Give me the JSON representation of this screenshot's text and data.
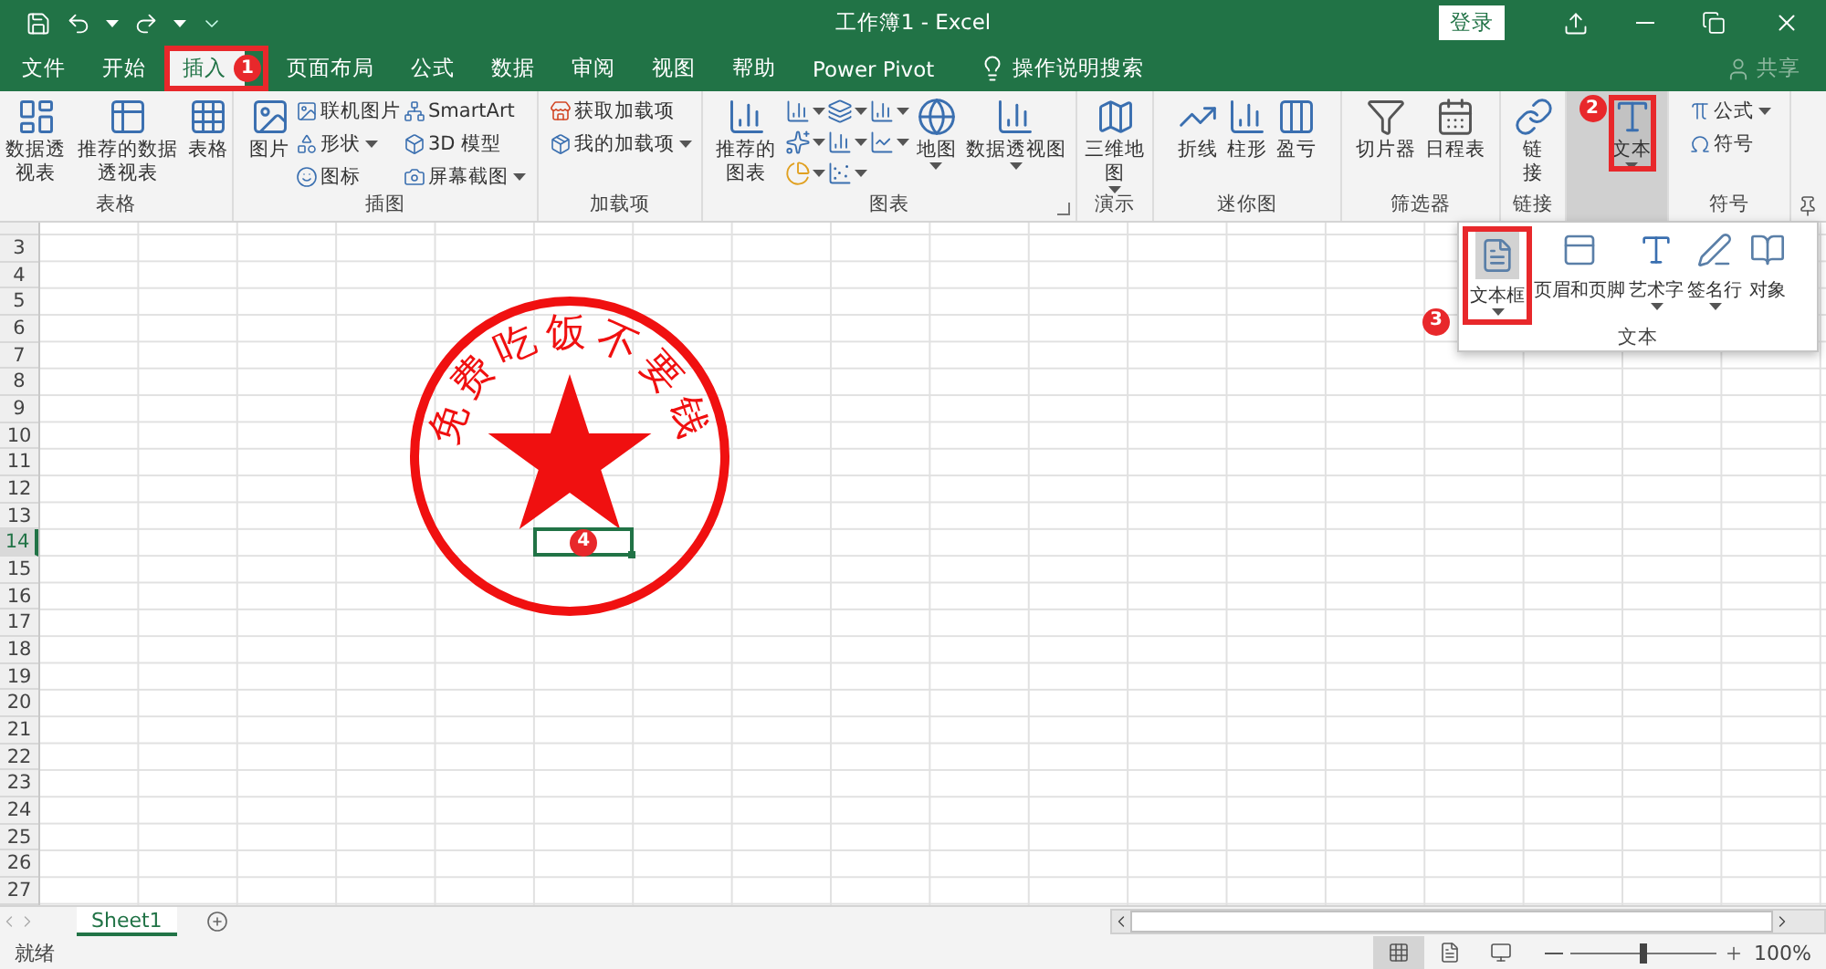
{
  "title_bar": {
    "title": "工作簿1 - Excel",
    "sign_in": "登录"
  },
  "tabs": [
    {
      "label": "文件",
      "selected": false
    },
    {
      "label": "开始",
      "selected": false
    },
    {
      "label": "插入",
      "selected": true,
      "annotation": "1"
    },
    {
      "label": "页面布局",
      "selected": false
    },
    {
      "label": "公式",
      "selected": false
    },
    {
      "label": "数据",
      "selected": false
    },
    {
      "label": "审阅",
      "selected": false
    },
    {
      "label": "视图",
      "selected": false
    },
    {
      "label": "帮助",
      "selected": false
    },
    {
      "label": "Power Pivot",
      "selected": false
    }
  ],
  "tell_me": "操作说明搜索",
  "share": "共享",
  "ribbon": [
    {
      "label": "表格",
      "items": [
        {
          "kind": "large",
          "label": "数据透视表"
        },
        {
          "kind": "large",
          "label": "推荐的数据透视表"
        },
        {
          "kind": "large",
          "label": "表格"
        }
      ]
    },
    {
      "label": "插图",
      "items": [
        {
          "kind": "large",
          "label": "图片"
        },
        {
          "kind": "column",
          "items": [
            {
              "label": "联机图片",
              "dropdown": false
            },
            {
              "label": "形状",
              "dropdown": true
            },
            {
              "label": "图标",
              "dropdown": false
            }
          ]
        },
        {
          "kind": "column",
          "items": [
            {
              "label": "SmartArt",
              "dropdown": false
            },
            {
              "label": "3D 模型",
              "dropdown": false
            },
            {
              "label": "屏幕截图",
              "dropdown": true
            }
          ]
        }
      ]
    },
    {
      "label": "加载项",
      "items": [
        {
          "kind": "column",
          "items": [
            {
              "label": "获取加载项",
              "dropdown": false
            },
            {
              "label": "我的加载项",
              "dropdown": true
            }
          ]
        }
      ]
    },
    {
      "label": "图表",
      "launcher": true,
      "items": [
        {
          "kind": "large",
          "label": "推荐的图表"
        },
        {
          "kind": "icon_grid"
        },
        {
          "kind": "large",
          "label": "地图",
          "dropdown": true
        },
        {
          "kind": "large",
          "label": "数据透视图",
          "dropdown": true
        }
      ]
    },
    {
      "label": "演示",
      "items": [
        {
          "kind": "large",
          "label": "三维地图",
          "dropdown": true
        }
      ]
    },
    {
      "label": "迷你图",
      "items": [
        {
          "kind": "large",
          "label": "折线"
        },
        {
          "kind": "large",
          "label": "柱形"
        },
        {
          "kind": "large",
          "label": "盈亏"
        }
      ]
    },
    {
      "label": "筛选器",
      "items": [
        {
          "kind": "large",
          "label": "切片器"
        },
        {
          "kind": "large",
          "label": "日程表"
        }
      ]
    },
    {
      "label": "链接",
      "items": [
        {
          "kind": "large",
          "label": "链接"
        }
      ]
    },
    {
      "items": [
        {
          "kind": "large",
          "label": "文本",
          "dropdown": true,
          "expanded": true,
          "annotation": "2"
        }
      ]
    },
    {
      "label": "符号",
      "items": [
        {
          "kind": "column",
          "items": [
            {
              "label": "公式",
              "dropdown": true
            },
            {
              "label": "符号",
              "dropdown": false
            }
          ]
        }
      ]
    }
  ],
  "text_menu": {
    "label": "文本",
    "items": [
      {
        "label": "文本框",
        "dropdown": true,
        "highlighted": true,
        "annotation": "3"
      },
      {
        "label": "页眉和页脚",
        "dropdown": false,
        "highlighted": false
      },
      {
        "label": "艺术字",
        "dropdown": true,
        "highlighted": false
      },
      {
        "label": "签名行",
        "dropdown": true,
        "highlighted": false
      },
      {
        "label": "对象",
        "dropdown": false,
        "highlighted": false
      }
    ]
  },
  "stamp": {
    "text": "免费吃饭不要钱"
  },
  "grid": {
    "selected_cell_annotation": "4",
    "rows": [
      {
        "label": "3",
        "selected": false
      },
      {
        "label": "4",
        "selected": false
      },
      {
        "label": "5",
        "selected": false
      },
      {
        "label": "6",
        "selected": false
      },
      {
        "label": "7",
        "selected": false
      },
      {
        "label": "8",
        "selected": false
      },
      {
        "label": "9",
        "selected": false
      },
      {
        "label": "10",
        "selected": false
      },
      {
        "label": "11",
        "selected": false
      },
      {
        "label": "12",
        "selected": false
      },
      {
        "label": "13",
        "selected": false
      },
      {
        "label": "14",
        "selected": true
      },
      {
        "label": "15",
        "selected": false
      },
      {
        "label": "16",
        "selected": false
      },
      {
        "label": "17",
        "selected": false
      },
      {
        "label": "18",
        "selected": false
      },
      {
        "label": "19",
        "selected": false
      },
      {
        "label": "20",
        "selected": false
      },
      {
        "label": "21",
        "selected": false
      },
      {
        "label": "22",
        "selected": false
      },
      {
        "label": "23",
        "selected": false
      },
      {
        "label": "24",
        "selected": false
      },
      {
        "label": "25",
        "selected": false
      },
      {
        "label": "26",
        "selected": false
      },
      {
        "label": "27",
        "selected": false
      }
    ]
  },
  "sheet_tabs": [
    {
      "label": "Sheet1",
      "selected": true
    }
  ],
  "status_bar": {
    "status": "就绪",
    "zoom": {
      "level": 0.5,
      "reading": "100%"
    }
  }
}
